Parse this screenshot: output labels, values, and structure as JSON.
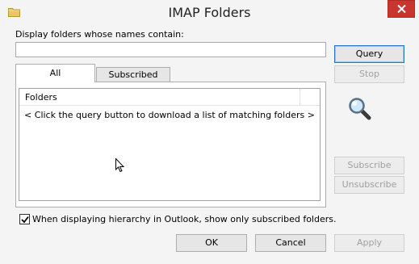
{
  "window": {
    "title": "IMAP Folders"
  },
  "search": {
    "label": "Display folders whose names contain:",
    "value": "",
    "placeholder": ""
  },
  "buttons": {
    "query": "Query",
    "stop": "Stop",
    "subscribe": "Subscribe",
    "unsubscribe": "Unsubscribe",
    "ok": "OK",
    "cancel": "Cancel",
    "apply": "Apply"
  },
  "tabs": [
    {
      "label": "All",
      "active": true
    },
    {
      "label": "Subscribed",
      "active": false
    }
  ],
  "folder_list": {
    "column_header": "Folders",
    "empty_message": "< Click the query button to download a list of matching folders >"
  },
  "options": {
    "show_subscribed_only_label": "When displaying hierarchy in Outlook, show only subscribed folders.",
    "show_subscribed_only_checked": true
  },
  "icons": {
    "title": "folder-icon",
    "close": "close-icon",
    "search": "magnifier-icon",
    "check": "checkmark-icon",
    "cursor": "mouse-cursor-icon"
  },
  "colors": {
    "close_button": "#c7372f",
    "default_button_border": "#2f74c0",
    "disabled_text": "#a0a0a0"
  }
}
